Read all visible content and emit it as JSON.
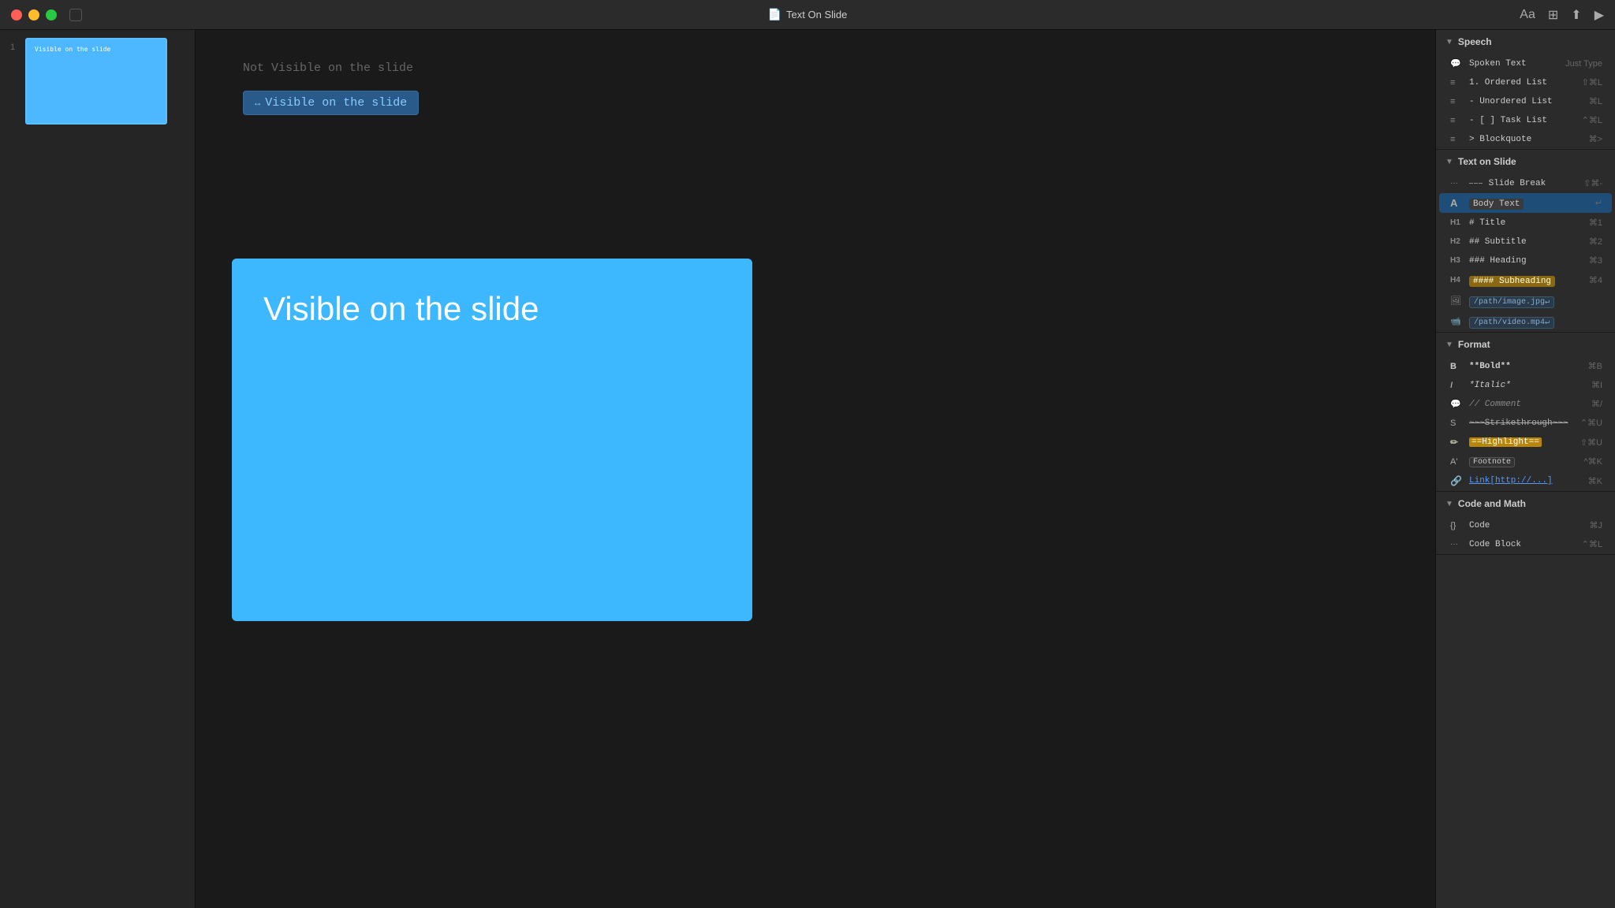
{
  "titlebar": {
    "title": "Text On Slide",
    "doc_icon": "📄",
    "buttons": {
      "close": "close",
      "minimize": "minimize",
      "maximize": "maximize"
    }
  },
  "editor": {
    "not_visible_text": "Not Visible on the slide",
    "visible_badge_text": "Visible on the slide",
    "slide_preview_title": "Visible on the slide"
  },
  "slide_thumbnail": {
    "number": "1",
    "label": "Visible on the slide"
  },
  "right_panel": {
    "speech_section": {
      "header": "Speech",
      "items": [
        {
          "icon": "💬",
          "label": "Spoken Text",
          "shortcut": "Just Type"
        }
      ],
      "list_items": [
        {
          "icon": "≡",
          "label": "1. Ordered List",
          "shortcut": "⇧⌘L"
        },
        {
          "icon": "≡",
          "label": "- Unordered List",
          "shortcut": "⌘L"
        },
        {
          "icon": "≡",
          "label": "- [ ] Task List",
          "shortcut": "⌃⌘L"
        },
        {
          "icon": "≡",
          "label": "> Blockquote",
          "shortcut": "⌘>"
        }
      ]
    },
    "text_on_slide_section": {
      "header": "Text on Slide",
      "items": [
        {
          "icon": "···",
          "label": "Slide Break",
          "shortcut": "⇧⌘-",
          "style": "slide-break"
        },
        {
          "icon": "A",
          "label": "Body Text",
          "shortcut": "↵",
          "style": "body"
        },
        {
          "icon": "H1",
          "label": "# Title",
          "shortcut": "⌘1",
          "style": "title"
        },
        {
          "icon": "H2",
          "label": "## Subtitle",
          "shortcut": "⌘2",
          "style": "subtitle"
        },
        {
          "icon": "H3",
          "label": "### Heading",
          "shortcut": "⌘3",
          "style": "heading"
        },
        {
          "icon": "H4",
          "label": "#### Subheading",
          "shortcut": "⌘4",
          "style": "subheading"
        },
        {
          "icon": "🖼",
          "label": "/path/image.jpg",
          "shortcut": "",
          "style": "image"
        },
        {
          "icon": "📹",
          "label": "/path/video.mp4",
          "shortcut": "",
          "style": "video"
        }
      ]
    },
    "format_section": {
      "header": "Format",
      "items": [
        {
          "icon": "B",
          "label": "**Bold**",
          "shortcut": "⌘B",
          "style": "bold"
        },
        {
          "icon": "I",
          "label": "*Italic*",
          "shortcut": "⌘I",
          "style": "italic"
        },
        {
          "icon": "💬",
          "label": "// Comment",
          "shortcut": "⌘/",
          "style": "comment"
        },
        {
          "icon": "S",
          "label": "~~~Strikethrough~~~",
          "shortcut": "⌃⌘U",
          "style": "strikethrough"
        },
        {
          "icon": "✏",
          "label": "==Highlight==",
          "shortcut": "⇧⌘U",
          "style": "highlight"
        },
        {
          "icon": "A'",
          "label": "Footnote",
          "shortcut": "^⌘K",
          "style": "footnote"
        },
        {
          "icon": "🔗",
          "label": "Link[http://...]",
          "shortcut": "⌘K",
          "style": "link"
        }
      ]
    },
    "code_section": {
      "header": "Code and Math",
      "items": [
        {
          "icon": "{}",
          "label": "Code",
          "shortcut": "⌘J",
          "style": "code"
        },
        {
          "icon": "···",
          "label": "Code Block",
          "shortcut": "⌃⌘L",
          "style": "codeblock"
        }
      ]
    }
  }
}
